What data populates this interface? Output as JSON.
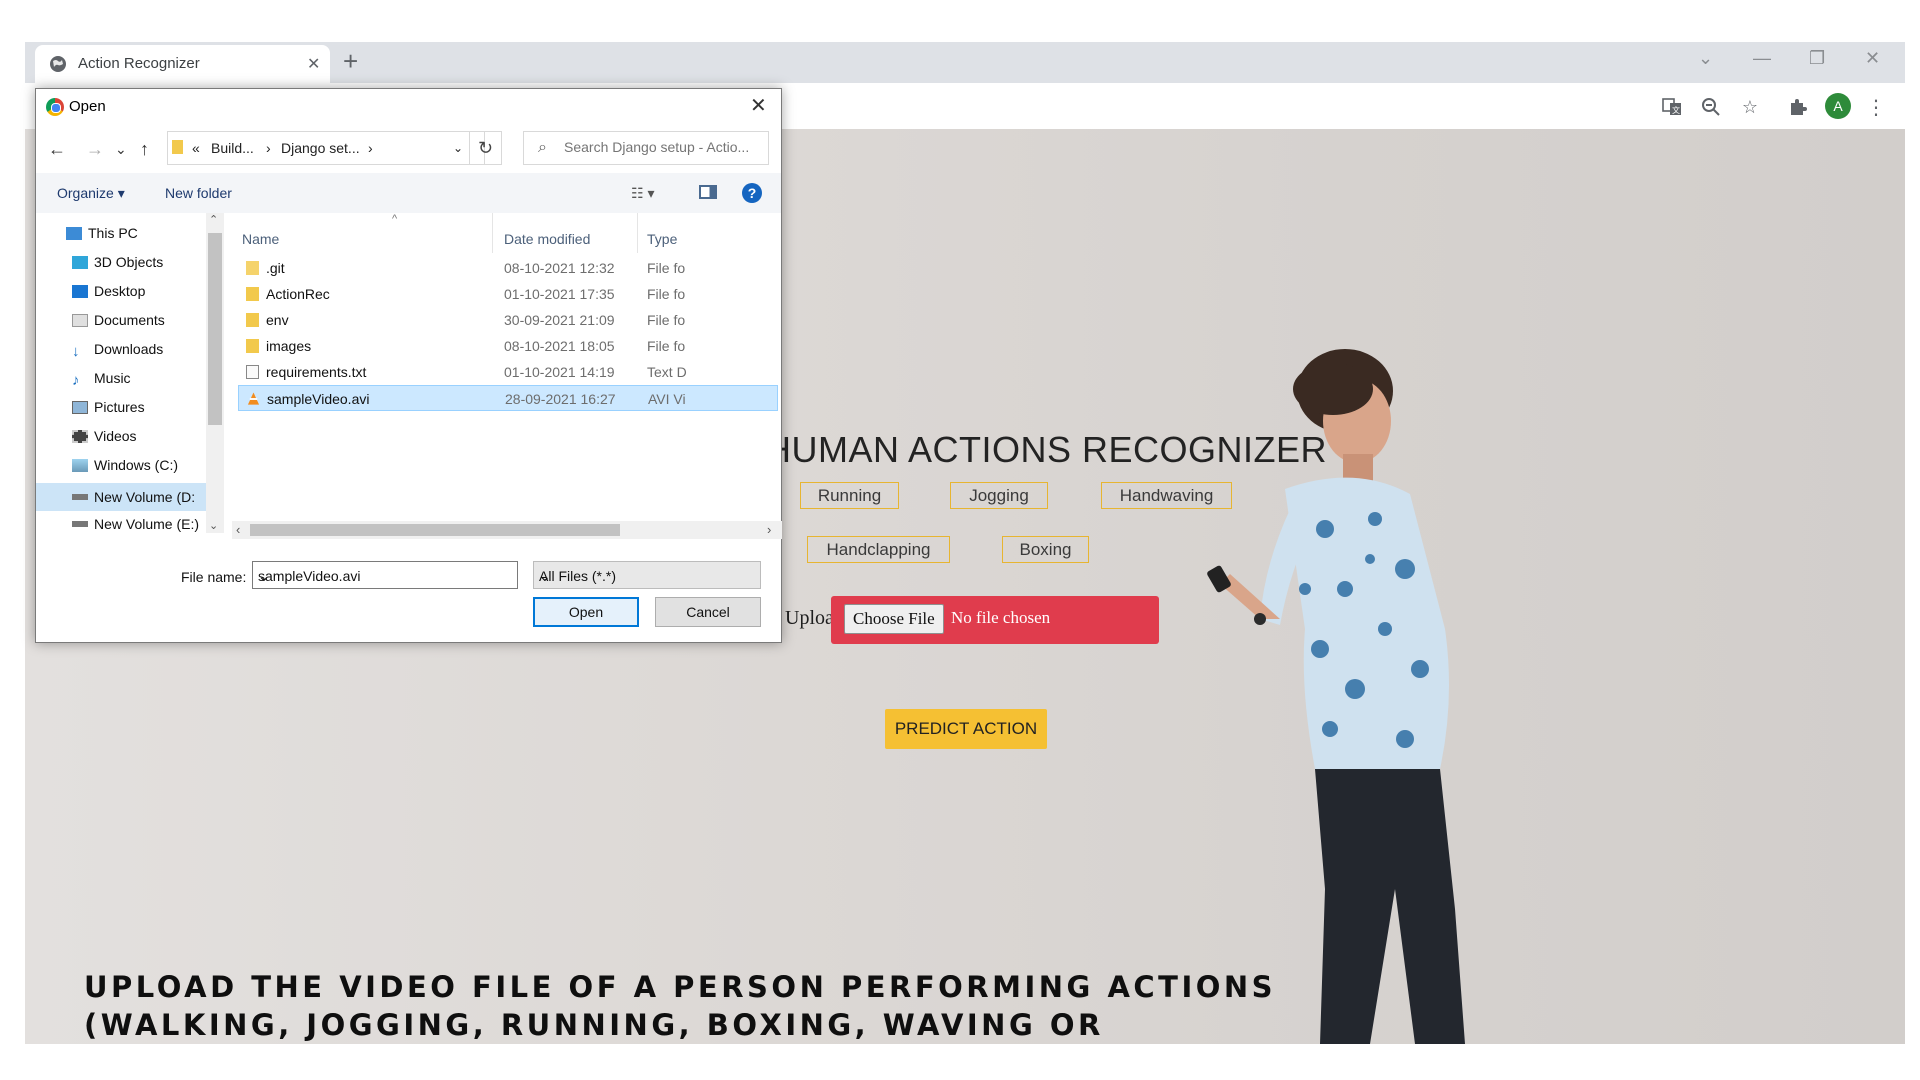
{
  "browser": {
    "tab_title": "Action Recognizer",
    "tab_close": "✕",
    "new_tab": "+",
    "window_controls": [
      "⌄",
      "—",
      "❐",
      "✕"
    ],
    "profile_initial": "A",
    "accent_color": "#2e8b3a"
  },
  "page": {
    "heading": "HUMAN ACTIONS RECOGNIZER",
    "actions": [
      "Running",
      "Jogging",
      "Handwaving",
      "Handclapping",
      "Boxing"
    ],
    "upload_label": "Upload Video:",
    "choose_file": "Choose File",
    "no_file": "No file chosen",
    "predict_button": "PREDICT ACTION",
    "caption": "Upload the video file of a person performing actions (walking, jogging, running, boxing, waving or clapping). The video should have minimum duration of 25 secs and recorded at 25fps.",
    "colors": {
      "chip_border": "#e7b531",
      "file_box": "#e03c4d",
      "predict": "#f5c033"
    }
  },
  "dialog": {
    "title": "Open",
    "close": "✕",
    "nav": {
      "back": "←",
      "forward": "→",
      "recent": "⌄",
      "up": "↑"
    },
    "breadcrumb": [
      "«",
      "Build...",
      "›",
      "Django set...",
      "›"
    ],
    "refresh": "↻",
    "search_placeholder": "Search Django setup - Actio...",
    "organize": "Organize ▾",
    "new_folder": "New folder",
    "view_icon": "☷ ▾",
    "help": "?",
    "nav_items": [
      {
        "label": "This PC",
        "icon": "pc-icon"
      },
      {
        "label": "3D Objects",
        "icon": "cube-icon"
      },
      {
        "label": "Desktop",
        "icon": "desktop-icon"
      },
      {
        "label": "Documents",
        "icon": "documents-icon"
      },
      {
        "label": "Downloads",
        "icon": "download-icon"
      },
      {
        "label": "Music",
        "icon": "music-icon"
      },
      {
        "label": "Pictures",
        "icon": "pictures-icon"
      },
      {
        "label": "Videos",
        "icon": "videos-icon"
      },
      {
        "label": "Windows (C:)",
        "icon": "drive-icon"
      },
      {
        "label": "New Volume (D:",
        "icon": "drive-icon"
      },
      {
        "label": "New Volume (E:)",
        "icon": "drive-icon"
      }
    ],
    "columns": [
      "Name",
      "Date modified",
      "Type"
    ],
    "files": [
      {
        "name": ".git",
        "date": "08-10-2021 12:32",
        "type": "File fo",
        "icon": "folder-icon"
      },
      {
        "name": "ActionRec",
        "date": "01-10-2021 17:35",
        "type": "File fo",
        "icon": "folder-icon"
      },
      {
        "name": "env",
        "date": "30-09-2021 21:09",
        "type": "File fo",
        "icon": "folder-icon"
      },
      {
        "name": "images",
        "date": "08-10-2021 18:05",
        "type": "File fo",
        "icon": "folder-icon"
      },
      {
        "name": "requirements.txt",
        "date": "01-10-2021 14:19",
        "type": "Text D",
        "icon": "text-file-icon"
      },
      {
        "name": "sampleVideo.avi",
        "date": "28-09-2021 16:27",
        "type": "AVI Vi",
        "icon": "vlc-icon"
      }
    ],
    "file_name_label": "File name:",
    "file_name_value": "sampleVideo.avi",
    "filter_value": "All Files (*.*)",
    "open_button": "Open",
    "cancel_button": "Cancel"
  }
}
